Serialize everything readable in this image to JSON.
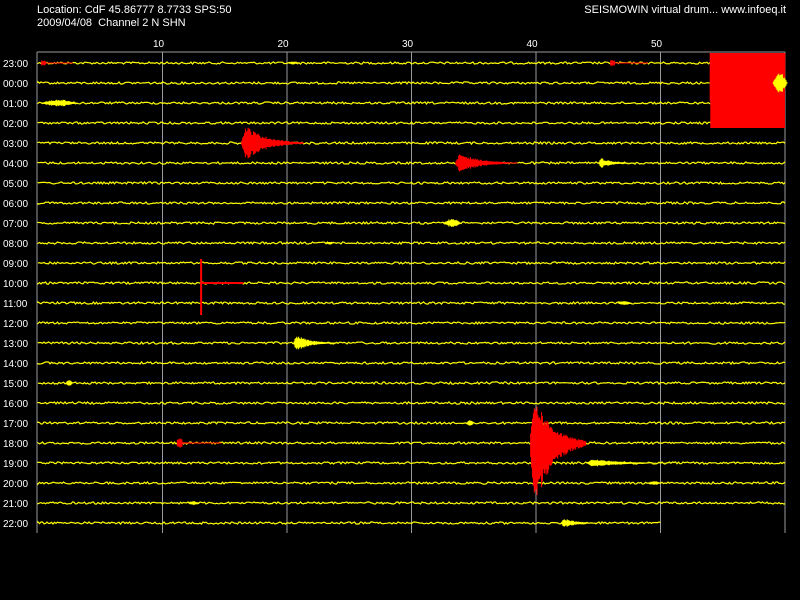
{
  "header": {
    "location": "Location: CdF 45.86777 8.7733 SPS:50",
    "date_channel": "2009/04/08  Channel 2 N SHN",
    "title_right": "SEISMOWIN virtual drum... www.infoeq.it"
  },
  "x_ticks": [
    "10",
    "20",
    "30",
    "40",
    "50"
  ],
  "hour_labels": [
    "23:00",
    "00:00",
    "01:00",
    "02:00",
    "03:00",
    "04:00",
    "05:00",
    "06:00",
    "07:00",
    "08:00",
    "09:00",
    "10:00",
    "11:00",
    "12:00",
    "13:00",
    "14:00",
    "15:00",
    "16:00",
    "17:00",
    "18:00",
    "19:00",
    "20:00",
    "21:00",
    "22:00"
  ],
  "colors": {
    "background": "#000000",
    "trace": "#ffff00",
    "event_trace": "#ff0000",
    "grid": "#9a9a9a",
    "text": "#ffffff"
  },
  "events": [
    {
      "row": 0,
      "minute": 0.3,
      "duration": 2.5,
      "amplitude": 0.25,
      "color": "red",
      "shape": "spike"
    },
    {
      "row": 0,
      "minute": 20,
      "duration": 1.0,
      "amplitude": 0.15,
      "color": "yellow",
      "shape": "burst"
    },
    {
      "row": 0,
      "minute": 46,
      "duration": 3.0,
      "amplitude": 0.3,
      "color": "red",
      "shape": "spike"
    },
    {
      "row": 0,
      "minute": 54,
      "duration": 6.0,
      "amplitude": 6.5,
      "color": "red",
      "shape": "block"
    },
    {
      "row": 1,
      "minute": 59,
      "duration": 1.2,
      "amplitude": 1.0,
      "color": "yellow",
      "shape": "burst"
    },
    {
      "row": 2,
      "minute": 0.2,
      "duration": 3.0,
      "amplitude": 0.35,
      "color": "yellow",
      "shape": "burst"
    },
    {
      "row": 4,
      "minute": 16.3,
      "duration": 5.0,
      "amplitude": 1.8,
      "color": "red",
      "shape": "quake"
    },
    {
      "row": 5,
      "minute": 33.5,
      "duration": 5.0,
      "amplitude": 1.0,
      "color": "red",
      "shape": "quake"
    },
    {
      "row": 5,
      "minute": 45.0,
      "duration": 3.0,
      "amplitude": 0.5,
      "color": "yellow",
      "shape": "quake"
    },
    {
      "row": 8,
      "minute": 32.5,
      "duration": 1.5,
      "amplitude": 0.4,
      "color": "yellow",
      "shape": "burst"
    },
    {
      "row": 9,
      "minute": 23,
      "duration": 0.8,
      "amplitude": 0.15,
      "color": "yellow",
      "shape": "burst"
    },
    {
      "row": 11,
      "minute": 13.1,
      "duration": 3.4,
      "amplitude": 4.0,
      "color": "red",
      "shape": "line"
    },
    {
      "row": 12,
      "minute": 46.5,
      "duration": 1.2,
      "amplitude": 0.2,
      "color": "yellow",
      "shape": "burst"
    },
    {
      "row": 14,
      "minute": 20.5,
      "duration": 3.5,
      "amplitude": 0.8,
      "color": "yellow",
      "shape": "quake"
    },
    {
      "row": 16,
      "minute": 2.2,
      "duration": 0.6,
      "amplitude": 0.35,
      "color": "yellow",
      "shape": "burst"
    },
    {
      "row": 18,
      "minute": 34.4,
      "duration": 0.6,
      "amplitude": 0.3,
      "color": "yellow",
      "shape": "burst"
    },
    {
      "row": 19,
      "minute": 11.2,
      "duration": 3.5,
      "amplitude": 0.5,
      "color": "red",
      "shape": "spike"
    },
    {
      "row": 19,
      "minute": 39.5,
      "duration": 4.5,
      "amplitude": 7.0,
      "color": "red",
      "shape": "bigquake"
    },
    {
      "row": 20,
      "minute": 44.0,
      "duration": 7.0,
      "amplitude": 0.4,
      "color": "yellow",
      "shape": "quake"
    },
    {
      "row": 21,
      "minute": 49,
      "duration": 1.0,
      "amplitude": 0.2,
      "color": "yellow",
      "shape": "burst"
    },
    {
      "row": 22,
      "minute": 12,
      "duration": 1.0,
      "amplitude": 0.2,
      "color": "yellow",
      "shape": "burst"
    },
    {
      "row": 23,
      "minute": 42,
      "duration": 3.0,
      "amplitude": 0.5,
      "color": "yellow",
      "shape": "quake"
    }
  ],
  "last_row_end_minute": 50
}
